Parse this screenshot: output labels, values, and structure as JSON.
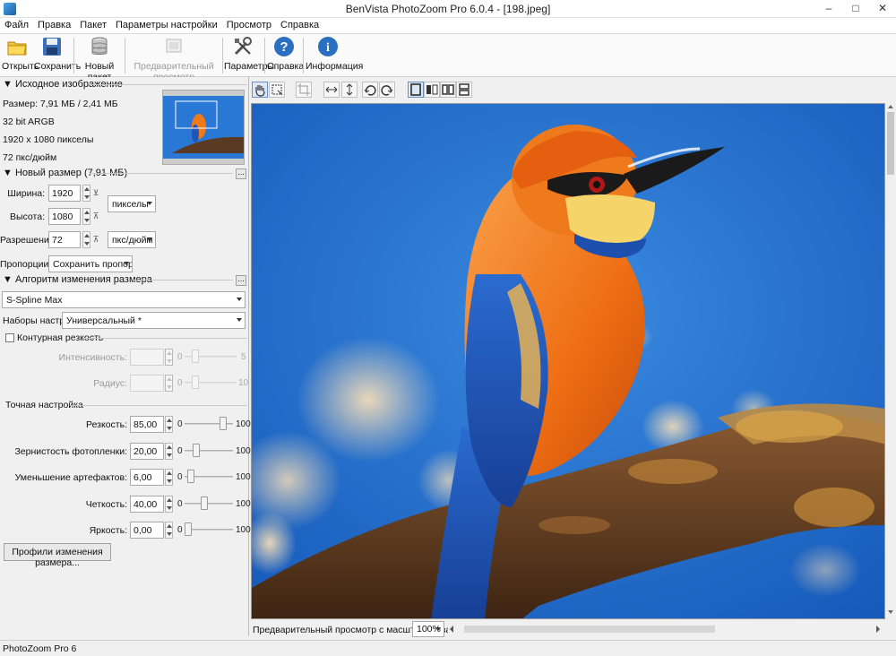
{
  "window": {
    "title": "BenVista PhotoZoom Pro 6.0.4 - [198.jpeg]"
  },
  "menu": [
    "Файл",
    "Правка",
    "Пакет",
    "Параметры настройки",
    "Просмотр",
    "Справка"
  ],
  "toolbar": {
    "open": "Открыть",
    "save": "Сохранить",
    "batch": "Новый пакет",
    "preview": "Предварительный просмотр",
    "settings": "Параметры",
    "help": "Справка",
    "info": "Информация"
  },
  "source": {
    "header": "Исходное изображение",
    "size": "Размер: 7,91 МБ / 2,41 МБ",
    "bits": "32 bit ARGB",
    "dims": "1920 x 1080 пикселы",
    "dpi": "72 пкс/дюйм"
  },
  "newsize": {
    "header": "Новый размер (7,91 МБ)",
    "width_label": "Ширина:",
    "width": "1920",
    "height_label": "Высота:",
    "height": "1080",
    "unit": "пикселы",
    "res_label": "Разрешение:",
    "res": "72",
    "res_unit": "пкс/дюйм",
    "prop_label": "Пропорции:",
    "prop": "Сохранить пропорции",
    "more": "..."
  },
  "algo": {
    "header": "Алгоритм изменения размера",
    "method": "S-Spline Max",
    "preset_label": "Наборы настроек:",
    "preset": "Универсальный *",
    "more": "..."
  },
  "sharpen": {
    "label": "Контурная резкость",
    "intensity_label": "Интенсивность:",
    "radius_label": "Радиус:",
    "min": "0",
    "intensity_max": "5",
    "radius_max": "10"
  },
  "fine": {
    "header": "Точная настройка",
    "rows": [
      {
        "label": "Резкость:",
        "value": "85,00",
        "min": "0",
        "max": "100",
        "level": 0.85
      },
      {
        "label": "Зернистость фотопленки:",
        "value": "20,00",
        "min": "0",
        "max": "100",
        "level": 0.2
      },
      {
        "label": "Уменьшение артефактов:",
        "value": "6,00",
        "min": "0",
        "max": "100",
        "level": 0.06
      },
      {
        "label": "Четкость:",
        "value": "40,00",
        "min": "0",
        "max": "100",
        "level": 0.4
      },
      {
        "label": "Яркость:",
        "value": "0,00",
        "min": "0",
        "max": "100",
        "level": 0.0
      }
    ],
    "profiles_button": "Профили изменения размера..."
  },
  "preview_bar": {
    "label": "Предварительный просмотр с масштабированием:",
    "zoom": "100%"
  },
  "status": "PhotoZoom Pro 6",
  "colors": {
    "sky": "#1f6fcf",
    "bird_orange": "#f07a1a",
    "bird_blue": "#1f55b8",
    "accent": "#2a6fc0"
  }
}
